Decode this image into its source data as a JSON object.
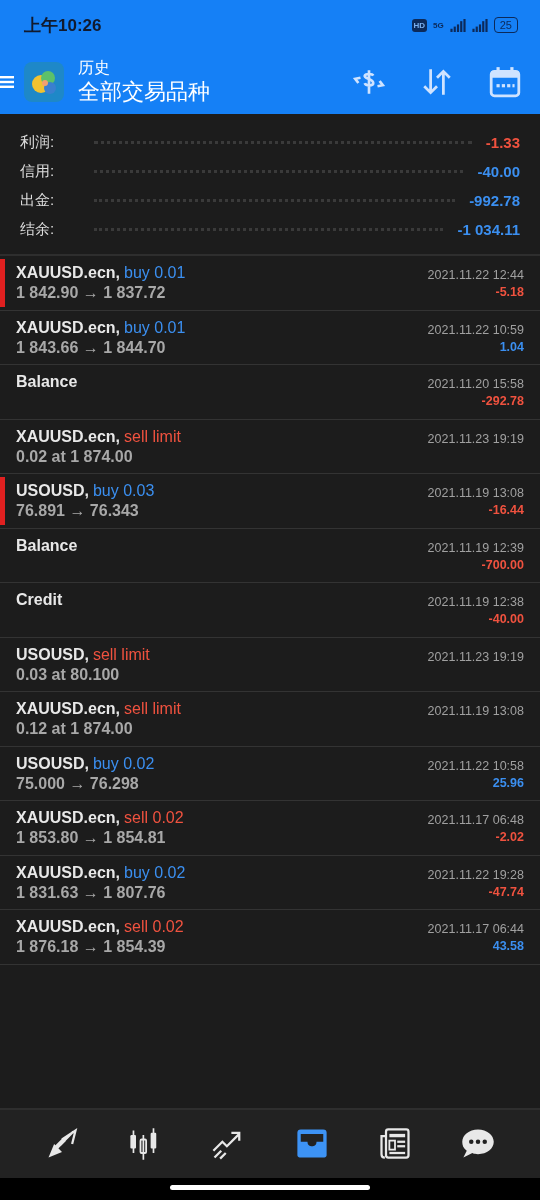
{
  "status_bar": {
    "time": "上午10:26",
    "hd": "HD",
    "network": "5G",
    "battery": "25"
  },
  "header": {
    "title": "历史",
    "subtitle": "全部交易品种"
  },
  "summary": [
    {
      "label": "利润:",
      "value": "-1.33",
      "color": "#f0523f"
    },
    {
      "label": "信用:",
      "value": "-40.00",
      "color": "#3b8ff0"
    },
    {
      "label": "出金:",
      "value": "-992.78",
      "color": "#3b8ff0"
    },
    {
      "label": "结余:",
      "value": "-1 034.11",
      "color": "#3b8ff0"
    }
  ],
  "rows": [
    {
      "symbol": "XAUUSD.ecn,",
      "action": {
        "text": "buy 0.01",
        "color": "#3b8ff0"
      },
      "detail": "1 842.90 → 1 837.72",
      "time": "2021.11.22 12:44",
      "profit": {
        "text": "-5.18",
        "color": "#f0523f"
      },
      "flagged": true
    },
    {
      "symbol": "XAUUSD.ecn,",
      "action": {
        "text": "buy 0.01",
        "color": "#3b8ff0"
      },
      "detail": "1 843.66 → 1 844.70",
      "time": "2021.11.22 10:59",
      "profit": {
        "text": "1.04",
        "color": "#3b8ff0"
      },
      "flagged": false
    },
    {
      "symbol": "Balance",
      "time": "2021.11.20 15:58",
      "profit": {
        "text": "-292.78",
        "color": "#f0523f"
      },
      "flagged": false
    },
    {
      "symbol": "XAUUSD.ecn,",
      "action": {
        "text": "sell limit",
        "color": "#f0523f"
      },
      "detail": "0.02 at 1 874.00",
      "time": "2021.11.23 19:19",
      "flagged": false
    },
    {
      "symbol": "USOUSD,",
      "action": {
        "text": "buy 0.03",
        "color": "#3b8ff0"
      },
      "detail": "76.891 → 76.343",
      "time": "2021.11.19 13:08",
      "profit": {
        "text": "-16.44",
        "color": "#f0523f"
      },
      "flagged": true
    },
    {
      "symbol": "Balance",
      "time": "2021.11.19 12:39",
      "profit": {
        "text": "-700.00",
        "color": "#f0523f"
      },
      "flagged": false
    },
    {
      "symbol": "Credit",
      "time": "2021.11.19 12:38",
      "profit": {
        "text": "-40.00",
        "color": "#f0523f"
      },
      "flagged": false
    },
    {
      "symbol": "USOUSD,",
      "action": {
        "text": "sell limit",
        "color": "#f0523f"
      },
      "detail": "0.03 at 80.100",
      "time": "2021.11.23 19:19",
      "flagged": false
    },
    {
      "symbol": "XAUUSD.ecn,",
      "action": {
        "text": "sell limit",
        "color": "#f0523f"
      },
      "detail": "0.12 at 1 874.00",
      "time": "2021.11.19 13:08",
      "flagged": false
    },
    {
      "symbol": "USOUSD,",
      "action": {
        "text": "buy 0.02",
        "color": "#3b8ff0"
      },
      "detail": "75.000 → 76.298",
      "time": "2021.11.22 10:58",
      "profit": {
        "text": "25.96",
        "color": "#3b8ff0"
      },
      "flagged": false
    },
    {
      "symbol": "XAUUSD.ecn,",
      "action": {
        "text": "sell 0.02",
        "color": "#f0523f"
      },
      "detail": "1 853.80 → 1 854.81",
      "time": "2021.11.17 06:48",
      "profit": {
        "text": "-2.02",
        "color": "#f0523f"
      },
      "flagged": false
    },
    {
      "symbol": "XAUUSD.ecn,",
      "action": {
        "text": "buy 0.02",
        "color": "#3b8ff0"
      },
      "detail": "1 831.63 → 1 807.76",
      "time": "2021.11.22 19:28",
      "profit": {
        "text": "-47.74",
        "color": "#f0523f"
      },
      "flagged": false
    },
    {
      "symbol": "XAUUSD.ecn,",
      "action": {
        "text": "sell 0.02",
        "color": "#f0523f"
      },
      "detail": "1 876.18 → 1 854.39",
      "time": "2021.11.17 06:44",
      "profit": {
        "text": "43.58",
        "color": "#3b8ff0"
      },
      "flagged": false
    }
  ],
  "nav": [
    {
      "kind": "trade",
      "selected": false
    },
    {
      "kind": "chart",
      "selected": false
    },
    {
      "kind": "trend",
      "selected": false
    },
    {
      "kind": "history",
      "selected": true
    },
    {
      "kind": "news",
      "selected": false
    },
    {
      "kind": "chat",
      "selected": false
    }
  ]
}
